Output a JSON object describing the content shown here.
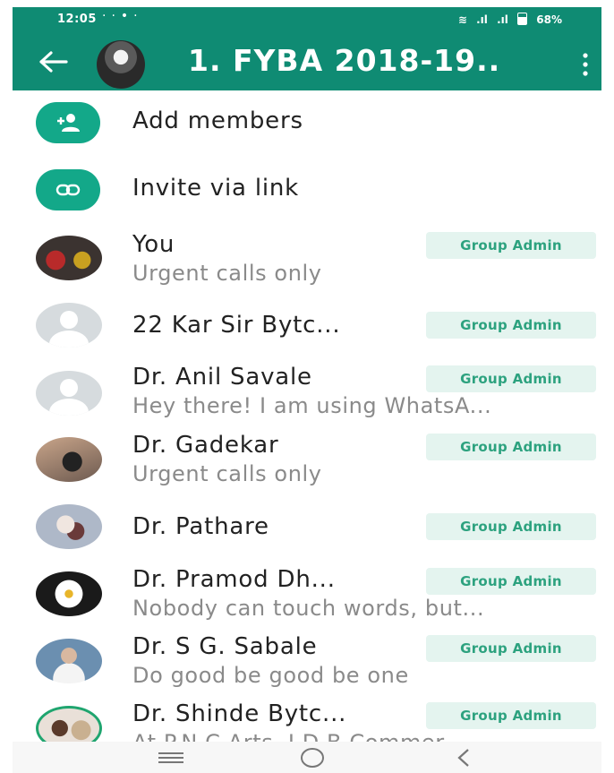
{
  "status_bar": {
    "time": "12:05",
    "battery": "68%"
  },
  "header": {
    "title": "1. FYBA 2018-19..",
    "colors": {
      "header_bg": "#0f8b73",
      "accent": "#13a889",
      "badge_bg": "#e4f4ef",
      "badge_text": "#2da27f"
    }
  },
  "actions": {
    "add_members": "Add members",
    "invite_link": "Invite via link"
  },
  "members": [
    {
      "name": "You",
      "status": "Urgent calls only",
      "badge": "Group Admin"
    },
    {
      "name": "22 Kar Sir Bytc...",
      "status": "",
      "badge": "Group Admin"
    },
    {
      "name": "Dr. Anil Savale",
      "status": "Hey there! I am using WhatsA...",
      "badge": "Group Admin"
    },
    {
      "name": "Dr. Gadekar",
      "status": "Urgent calls only",
      "badge": "Group Admin"
    },
    {
      "name": "Dr. Pathare",
      "status": "",
      "badge": "Group Admin"
    },
    {
      "name": "Dr. Pramod Dh...",
      "status": "Nobody can touch words, but...",
      "badge": "Group Admin"
    },
    {
      "name": "Dr. S G. Sabale",
      "status": "Do good be good be one",
      "badge": "Group Admin"
    },
    {
      "name": "Dr. Shinde Bytc...",
      "status": "At P.N.C Arts, J.D.B Commer...",
      "badge": "Group Admin"
    }
  ]
}
